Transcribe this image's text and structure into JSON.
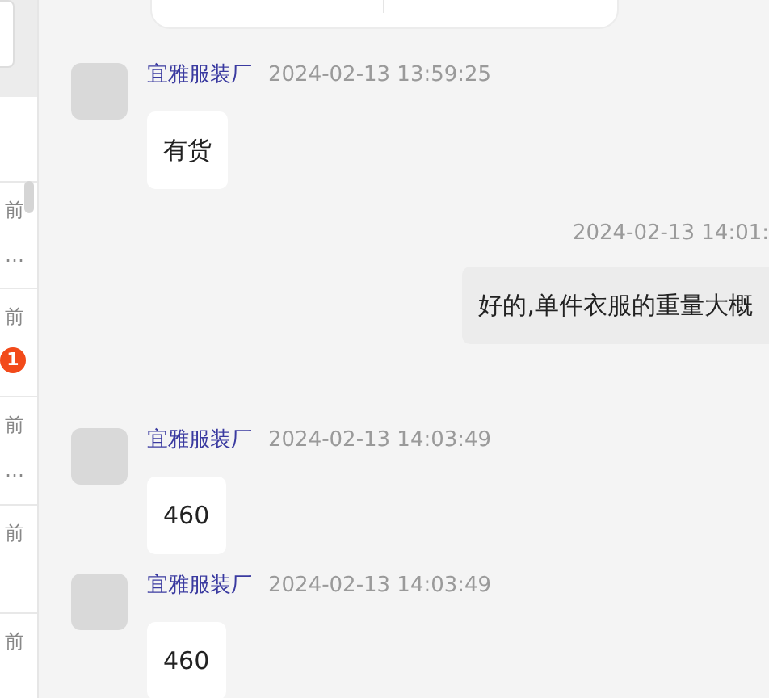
{
  "sidebar": {
    "items": [
      {
        "time": "前",
        "preview": "…"
      },
      {
        "time": "前",
        "badge": "1"
      },
      {
        "time": "前",
        "preview": "…"
      },
      {
        "time": "前"
      },
      {
        "time": "前"
      }
    ]
  },
  "messages": [
    {
      "kind": "received",
      "sender": "宜雅服装厂",
      "time": "2024-02-13 13:59:25",
      "text": "有货"
    },
    {
      "kind": "sent",
      "time": "2024-02-13 14:01:",
      "text": "好的,单件衣服的重量大概"
    },
    {
      "kind": "received",
      "sender": "宜雅服装厂",
      "time": "2024-02-13 14:03:49",
      "text": "460"
    },
    {
      "kind": "received",
      "sender": "宜雅服装厂",
      "time": "2024-02-13 14:03:49",
      "text": "460"
    }
  ]
}
